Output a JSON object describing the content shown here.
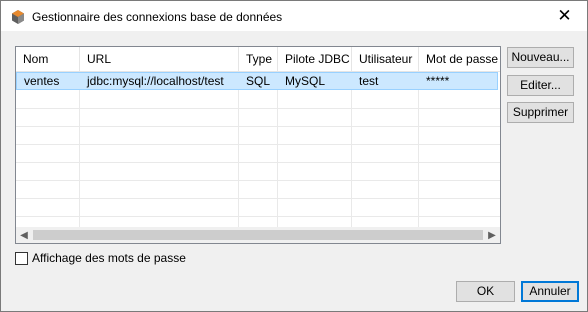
{
  "window": {
    "title": "Gestionnaire des connexions base de données"
  },
  "table": {
    "columns": [
      "Nom",
      "URL",
      "Type",
      "Pilote JDBC",
      "Utilisateur",
      "Mot de passe"
    ],
    "rows": [
      [
        "ventes",
        "jdbc:mysql://localhost/test",
        "SQL",
        "MySQL",
        "test",
        "*****"
      ]
    ]
  },
  "buttons": {
    "new": "Nouveau...",
    "edit": "Editer...",
    "delete": "Supprimer",
    "ok": "OK",
    "cancel": "Annuler"
  },
  "options": {
    "show_passwords_label": "Affichage des mots de passe",
    "show_passwords_checked": false
  },
  "colors": {
    "selection": "#cce8ff",
    "selection_border": "#99d1ff",
    "default_button_border": "#0078d7"
  }
}
